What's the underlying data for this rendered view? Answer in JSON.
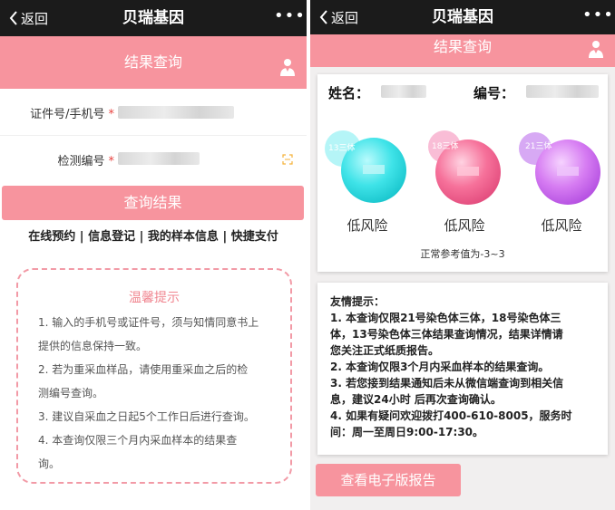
{
  "colors": {
    "pink": "#f7949e",
    "dark": "#1b1b1b",
    "cyan": "#2fe0e6",
    "rose": "#f2628e",
    "violet": "#cf6fee"
  },
  "left": {
    "titlebar": {
      "back_label": "返回",
      "title": "贝瑞基因",
      "more": "•••"
    },
    "header": {
      "title": "结果查询",
      "icon": "user-doctor-icon"
    },
    "form": {
      "id_label": "证件号/手机号",
      "id_required": "*",
      "code_label": "检测编号",
      "code_required": "*",
      "scan_icon": "scan-icon"
    },
    "query_button": "查询结果",
    "links": [
      "在线预约",
      "信息登记",
      "我的样本信息",
      "快捷支付"
    ],
    "link_sep": "|",
    "tips": {
      "title": "温馨提示",
      "lines": [
        "1. 输入的手机号或证件号，须与知情同意书上",
        "提供的信息保持一致。",
        "2. 若为重采血样品，请使用重采血之后的检",
        "测编号查询。",
        "3. 建议自采血之日起5个工作日后进行查询。",
        "4. 本查询仅限三个月内采血样本的结果查",
        "询。"
      ]
    }
  },
  "right": {
    "titlebar": {
      "back_label": "返回",
      "title": "贝瑞基因",
      "more": "•••"
    },
    "header": {
      "title": "结果查询",
      "icon": "user-doctor-icon"
    },
    "card": {
      "name_label": "姓名：",
      "number_label": "编号：",
      "results": [
        {
          "badge": "13三体",
          "risk": "低风险",
          "color": "#2fe0e6"
        },
        {
          "badge": "18三体",
          "risk": "低风险",
          "color": "#f2628e"
        },
        {
          "badge": "21三体",
          "risk": "低风险",
          "color": "#cf6fee"
        }
      ],
      "reference": "正常参考值为-3~3"
    },
    "tips": {
      "lines": [
        "友情提示：",
        "1. 本查询仅限21号染色体三体，18号染色体三",
        "体，13号染色体三体结果查询情况，结果详情请",
        "您关注正式纸质报告。",
        "2. 本查询仅限3个月内采血样本的结果查询。",
        "3. 若您接到结果通知后未从微信端查询到相关信",
        "息，建议24小时 后再次查询确认。",
        "4. 如果有疑问欢迎拨打400-610-8005，服务时",
        "间：周一至周日9:00-17:30。"
      ]
    },
    "report_button": "查看电子版报告"
  }
}
